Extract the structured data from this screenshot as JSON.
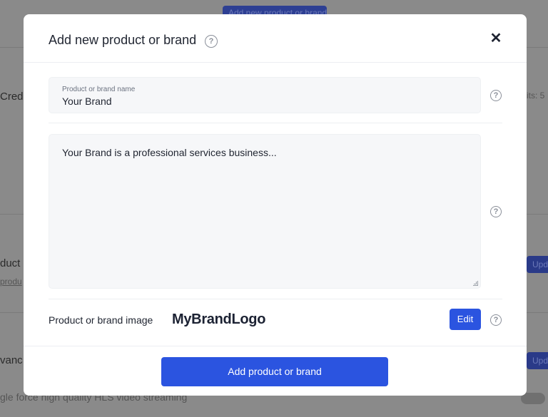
{
  "background": {
    "top_button": "Add new product or brand",
    "section1_title": "Cred",
    "section1_right_text": "its: 5",
    "section2_title": "duct",
    "section2_link": "produ",
    "section2_button": "Upd",
    "section3_title": "vanc",
    "section3_button": "Upd",
    "section3_text": "gle force high quality HLS video streaming"
  },
  "modal": {
    "title": "Add new product or brand",
    "help_glyph": "?",
    "close_glyph": "✕",
    "name_field": {
      "label": "Product or brand name",
      "value": "Your Brand"
    },
    "description_field": {
      "value": "Your Brand is a professional services business..."
    },
    "image_row": {
      "label": "Product or brand image",
      "logo_text": "MyBrandLogo",
      "edit_label": "Edit"
    },
    "submit_label": "Add product or brand"
  },
  "colors": {
    "accent": "#2b54e0",
    "overlay": "#8a8a8a",
    "field_bg": "#f6f7f9"
  }
}
